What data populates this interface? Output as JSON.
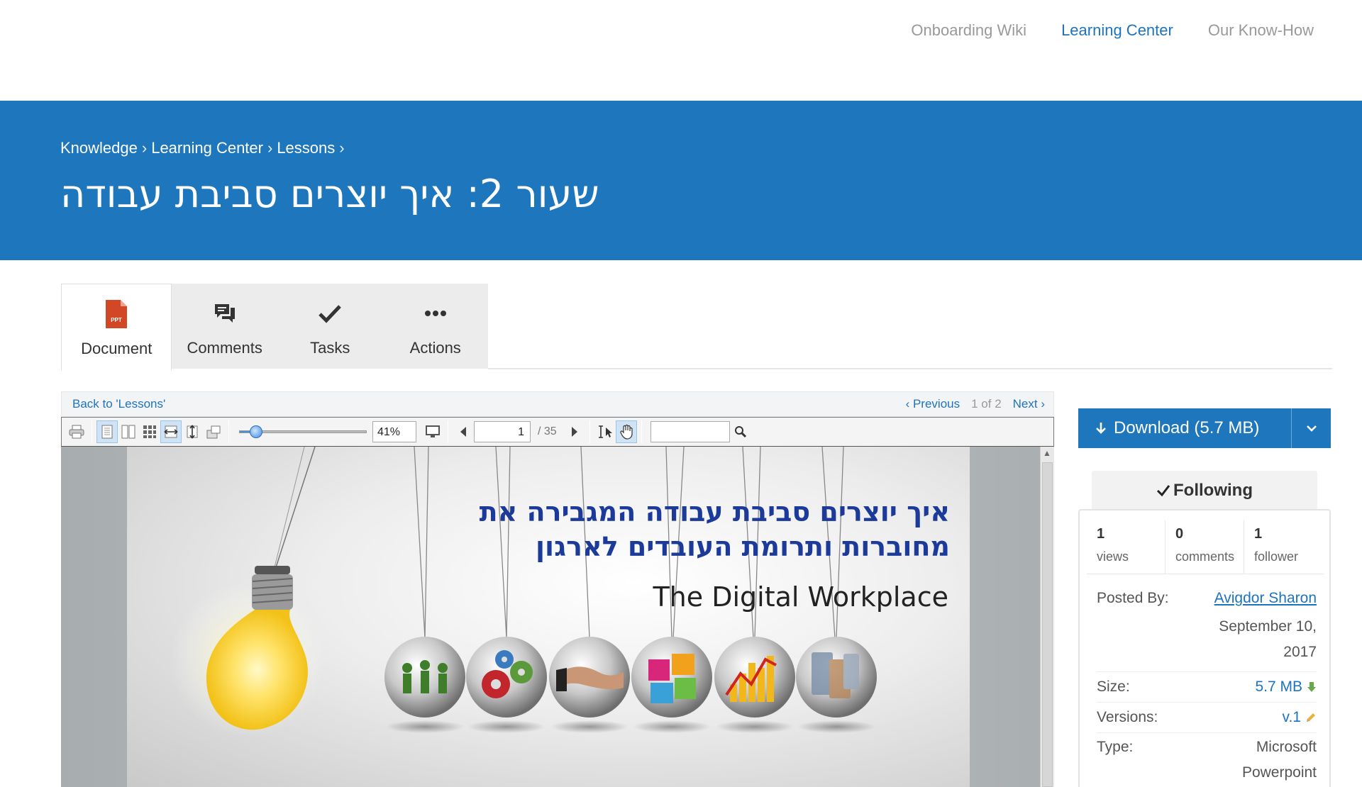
{
  "topnav": {
    "links": [
      "Onboarding Wiki",
      "Learning Center",
      "Our Know-How"
    ]
  },
  "banner": {
    "breadcrumb": [
      "Knowledge",
      "Learning Center",
      "Lessons"
    ],
    "separator": "›",
    "title": "שעור 2: איך יוצרים סביבת עבודה"
  },
  "tabs": [
    {
      "label": "Document",
      "icon": "ppt-file-icon"
    },
    {
      "label": "Comments",
      "icon": "comments-icon"
    },
    {
      "label": "Tasks",
      "icon": "check-icon"
    },
    {
      "label": "Actions",
      "icon": "ellipsis-icon"
    }
  ],
  "viewer": {
    "back_label": "Back to 'Lessons'",
    "previous_label": "‹ Previous",
    "count_label": "1 of 2",
    "next_label": "Next ›",
    "zoom_value": "41%",
    "zoom_fraction": 0.09,
    "page_value": "1",
    "page_total": "/ 35"
  },
  "slide": {
    "title_line1": "איך יוצרים סביבת עבודה המגבירה את",
    "title_line2": "מחוברות ותרומת העובדים לארגון",
    "subtitle": "The Digital Workplace"
  },
  "sidebar": {
    "download_label": "Download (5.7 MB)",
    "following_label": "Following",
    "stats": [
      {
        "num": "1",
        "label": "views"
      },
      {
        "num": "0",
        "label": "comments"
      },
      {
        "num": "1",
        "label": "follower"
      }
    ],
    "posted_by_label": "Posted By:",
    "posted_by_value": "Avigdor Sharon",
    "posted_date": "September 10, 2017",
    "size_label": "Size:",
    "size_value": "5.7 MB",
    "versions_label": "Versions:",
    "versions_value": "v.1",
    "type_label": "Type:",
    "type_value": "Microsoft Powerpoint"
  },
  "colors": {
    "brand_blue": "#1e76bd",
    "link_blue": "#1e73be",
    "ppt_orange": "#d24726",
    "slide_title_blue": "#1b3a9a"
  }
}
